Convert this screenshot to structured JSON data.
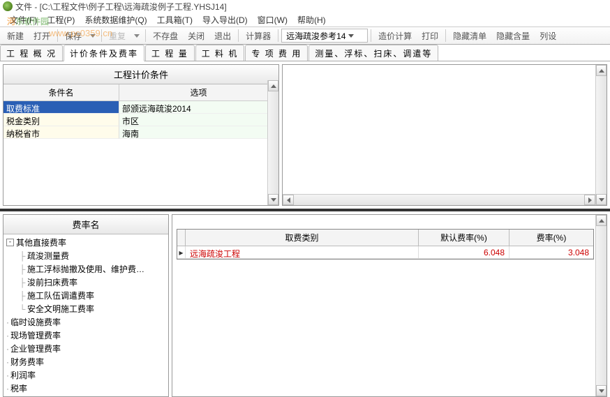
{
  "title": "文件 - [C:\\工程文件\\例子工程\\远海疏浚例子工程.YHSJ14]",
  "watermark": {
    "prefix": "河",
    "rest": "东软件园",
    "url": "www.pc0359.cn"
  },
  "menus": [
    "文件(F)",
    "工程(P)",
    "系统数据维护(Q)",
    "工具箱(T)",
    "导入导出(D)",
    "窗口(W)",
    "帮助(H)"
  ],
  "toolbar": {
    "new": "新建",
    "open": "打开",
    "save": "保存",
    "redo": "重复",
    "nosave": "不存盘",
    "close": "关闭",
    "exit": "退出",
    "calc": "计算器",
    "ref_select": "远海疏浚参考14",
    "price": "造价计算",
    "print": "打印",
    "hide_list": "隐藏清单",
    "hide_amount": "隐藏含量",
    "col_set": "列设"
  },
  "tabs": [
    "工 程 概 况",
    "计价条件及费率",
    "工    程    量",
    "工    料    机",
    "专 项 费 用",
    "测量、浮标、扫床、调遣等"
  ],
  "cond_panel": {
    "title": "工程计价条件",
    "head_name": "条件名",
    "head_opt": "选项",
    "rows": [
      {
        "name": "取费标准",
        "opt": "部颁远海疏浚2014"
      },
      {
        "name": "税金类别",
        "opt": "市区"
      },
      {
        "name": "纳税省市",
        "opt": "海南"
      }
    ]
  },
  "rate_panel": {
    "title": "费率名",
    "tree": {
      "root": "其他直接费率",
      "children": [
        "疏浚测量费",
        "施工浮标抛撤及使用、维护费…",
        "浚前扫床费率",
        "施工队伍调遣费率",
        "安全文明施工费率"
      ],
      "siblings": [
        "临时设施费率",
        "现场管理费率",
        "企业管理费率",
        "财务费率",
        "利润率",
        "税率"
      ]
    }
  },
  "fee_table": {
    "head_cat": "取费类别",
    "head_def": "默认费率(%)",
    "head_rate": "费率(%)",
    "rows": [
      {
        "cat": "远海疏浚工程",
        "def": "6.048",
        "rate": "3.048"
      }
    ]
  }
}
